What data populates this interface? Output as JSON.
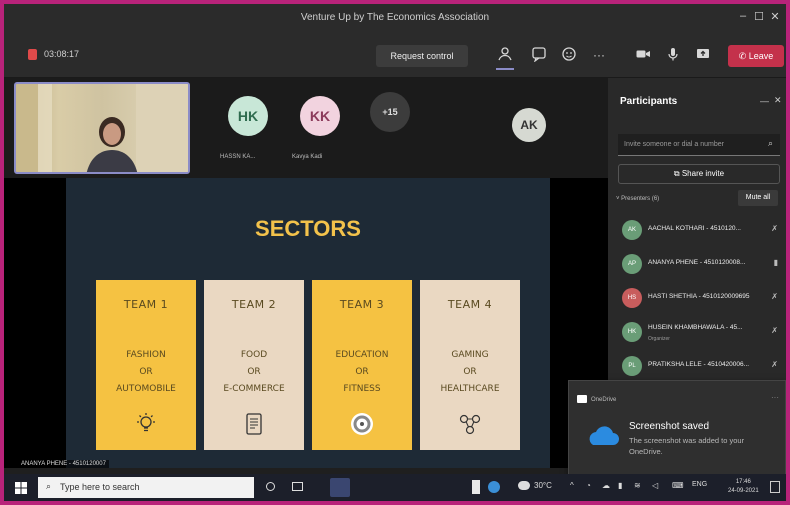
{
  "window": {
    "title": "Venture Up by The Economics Association",
    "minimize": "–",
    "maximize": "☐",
    "close": "✕"
  },
  "toolbar": {
    "timer": "03:08:17",
    "request_control": "Request control",
    "more": "···",
    "leave": "Leave"
  },
  "video_strip": {
    "participants": [
      {
        "initials": "HK",
        "name": "HASSN KA...",
        "color": "#c8e7d7",
        "text_color": "#2e6b4e"
      },
      {
        "initials": "KK",
        "name": "Kavya Kadi",
        "color": "#f2d3df",
        "text_color": "#8b3a5a"
      },
      {
        "initials": "+15",
        "color": "#3c3c3c",
        "text_color": "#e0e0e0"
      },
      {
        "initials": "AK",
        "color": "#d6d9d2",
        "text_color": "#333"
      }
    ]
  },
  "slide": {
    "title": "SECTORS",
    "teams": [
      {
        "team": "TEAM 1",
        "lines": [
          "FASHION",
          "OR",
          "AUTOMOBILE"
        ],
        "icon": "lightbulb-icon",
        "bg": "#f5c242"
      },
      {
        "team": "TEAM 2",
        "lines": [
          "FOOD",
          "OR",
          "E-COMMERCE"
        ],
        "icon": "tablet-icon",
        "bg": "#ead8c2"
      },
      {
        "team": "TEAM 3",
        "lines": [
          "EDUCATION",
          "OR",
          "FITNESS"
        ],
        "icon": "disc-icon",
        "bg": "#f5c242"
      },
      {
        "team": "TEAM 4",
        "lines": [
          "GAMING",
          "OR",
          "HEALTHCARE"
        ],
        "icon": "molecule-icon",
        "bg": "#ead8c2"
      }
    ],
    "speaker_label": "ANANYA PHENE - 4510120007"
  },
  "participants_panel": {
    "title": "Participants",
    "invite_placeholder": "Invite someone or dial a number",
    "share_invite": "Share invite",
    "section": "Presenters (6)",
    "mute_all": "Mute all",
    "people": [
      {
        "initials": "AK",
        "name": "AACHAL KOTHARI - 4510120..."
      },
      {
        "initials": "AP",
        "name": "ANANYA PHENE - 4510120008..."
      },
      {
        "initials": "HS",
        "name": "HASTI SHETHIA - 4510120009695"
      },
      {
        "initials": "HK",
        "name": "HUSEIN KHAMBHAWALA - 45...",
        "sub": "Organizer"
      },
      {
        "initials": "PL",
        "name": "PRATIKSHA LELE - 4510420006..."
      }
    ]
  },
  "toast": {
    "app": "OneDrive",
    "heading": "Screenshot saved",
    "body": "The screenshot was added to your OneDrive."
  },
  "taskbar": {
    "search_placeholder": "Type here to search",
    "temperature": "30°C",
    "language": "ENG",
    "time": "17:46",
    "date": "24-09-2021"
  }
}
